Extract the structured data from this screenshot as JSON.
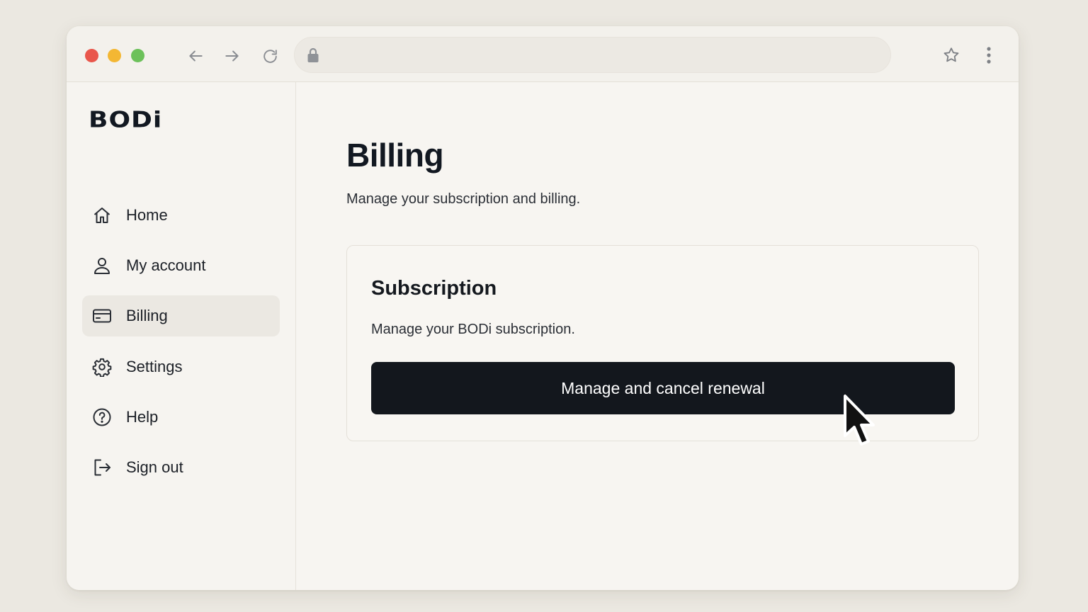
{
  "browser": {
    "address_value": "",
    "icons": [
      "back-arrow-icon",
      "forward-arrow-icon",
      "reload-icon",
      "lock-icon",
      "star-icon",
      "kebab-menu-icon"
    ],
    "traffic_lights": [
      "#e9564b",
      "#f3b733",
      "#6cc15a"
    ]
  },
  "brand": {
    "logo": "BODi"
  },
  "sidebar": {
    "items": [
      {
        "label": "Home",
        "icon": "home-icon",
        "active": false
      },
      {
        "label": "My account",
        "icon": "user-icon",
        "active": false
      },
      {
        "label": "Billing",
        "icon": "credit-card-icon",
        "active": true
      },
      {
        "label": "Settings",
        "icon": "gear-icon",
        "active": false
      },
      {
        "label": "Help",
        "icon": "help-circle-icon",
        "active": false
      },
      {
        "label": "Sign out",
        "icon": "sign-out-icon",
        "active": false
      }
    ]
  },
  "main": {
    "title": "Billing",
    "subtitle": "Manage your subscription and billing.",
    "card": {
      "title": "Subscription",
      "description": "Manage your BODi subscription.",
      "button_label": "Manage and cancel renewal"
    }
  },
  "colors": {
    "primary_button": "#13171d",
    "active_nav_bg": "#ebe8e2",
    "page_bg": "#ebe8e1"
  }
}
